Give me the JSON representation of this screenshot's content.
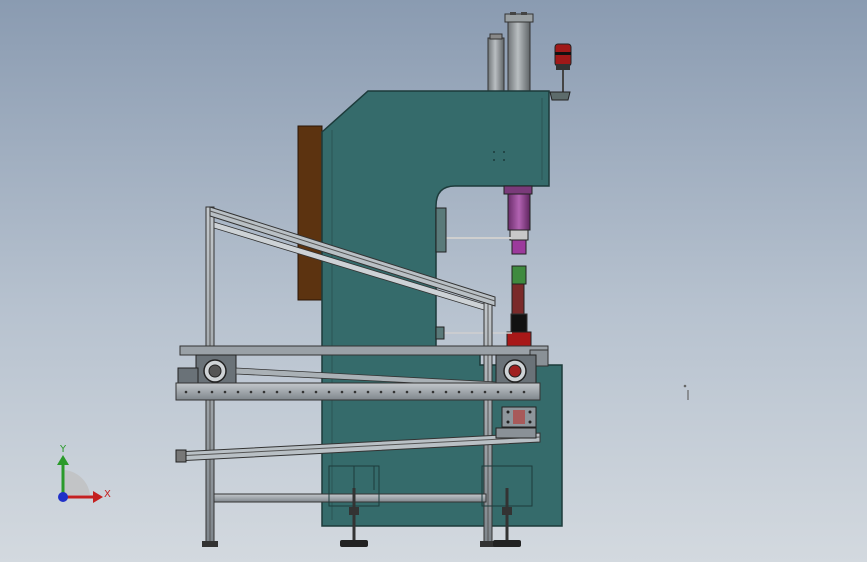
{
  "viewport": {
    "background_top": "#8a9bb1",
    "background_bottom": "#d3d9df"
  },
  "model": {
    "frame_color": "#356b6b",
    "plate_color": "#5c3310",
    "ram_color": "#8a3f8a",
    "die_color": "#3f8a3f",
    "warning_light_color": "#a01818",
    "rail_color": "#9ca3a9",
    "cylinder_color": "#8f9497"
  },
  "triad": {
    "x_label": "X",
    "y_label": "Y",
    "x_color": "#c42020",
    "y_color": "#2a9a2a",
    "z_color": "#2030c8"
  }
}
